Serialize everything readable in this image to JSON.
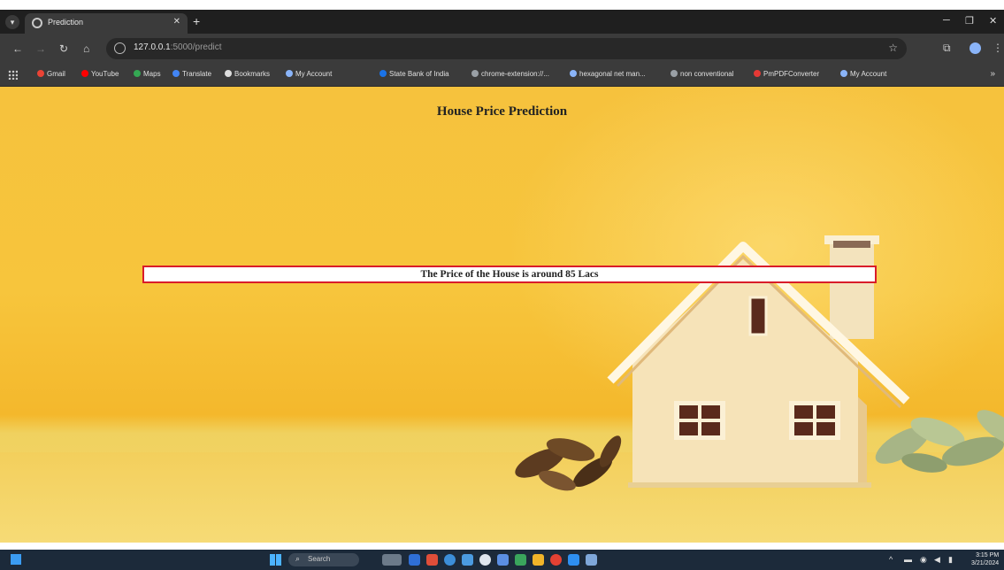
{
  "browser": {
    "tab_title": "Prediction",
    "tab_close": "✕",
    "new_tab": "+",
    "url_host": "127.0.0.1",
    "url_path": ":5000/predict",
    "minimize": "─",
    "maximize": "❐",
    "close": "✕"
  },
  "bookmarks": [
    {
      "label": "Gmail",
      "color": "#ea4335"
    },
    {
      "label": "YouTube",
      "color": "#ff0000"
    },
    {
      "label": "Maps",
      "color": "#34a853"
    },
    {
      "label": "Translate",
      "color": "#4285f4"
    },
    {
      "label": "Bookmarks",
      "color": "#dddddd"
    },
    {
      "label": "My Account",
      "color": "#8ab4f8"
    },
    {
      "label": "State Bank of India",
      "color": "#1a73e8"
    },
    {
      "label": "chrome-extension://...",
      "color": "#9aa0a6"
    },
    {
      "label": "hexagonal net man...",
      "color": "#8ab4f8"
    },
    {
      "label": "non conventional",
      "color": "#9aa0a6"
    },
    {
      "label": "PmPDFConverter",
      "color": "#e53935"
    },
    {
      "label": "My Account",
      "color": "#8ab4f8"
    }
  ],
  "page": {
    "title": "House Price Prediction",
    "result": "The Price of the House is around 85 Lacs"
  },
  "taskbar": {
    "search_label": "Search",
    "time": "3:15 PM",
    "date": "3/21/2024"
  },
  "colors": {
    "background": "#f6c23d",
    "result_border": "#d91c2a"
  }
}
